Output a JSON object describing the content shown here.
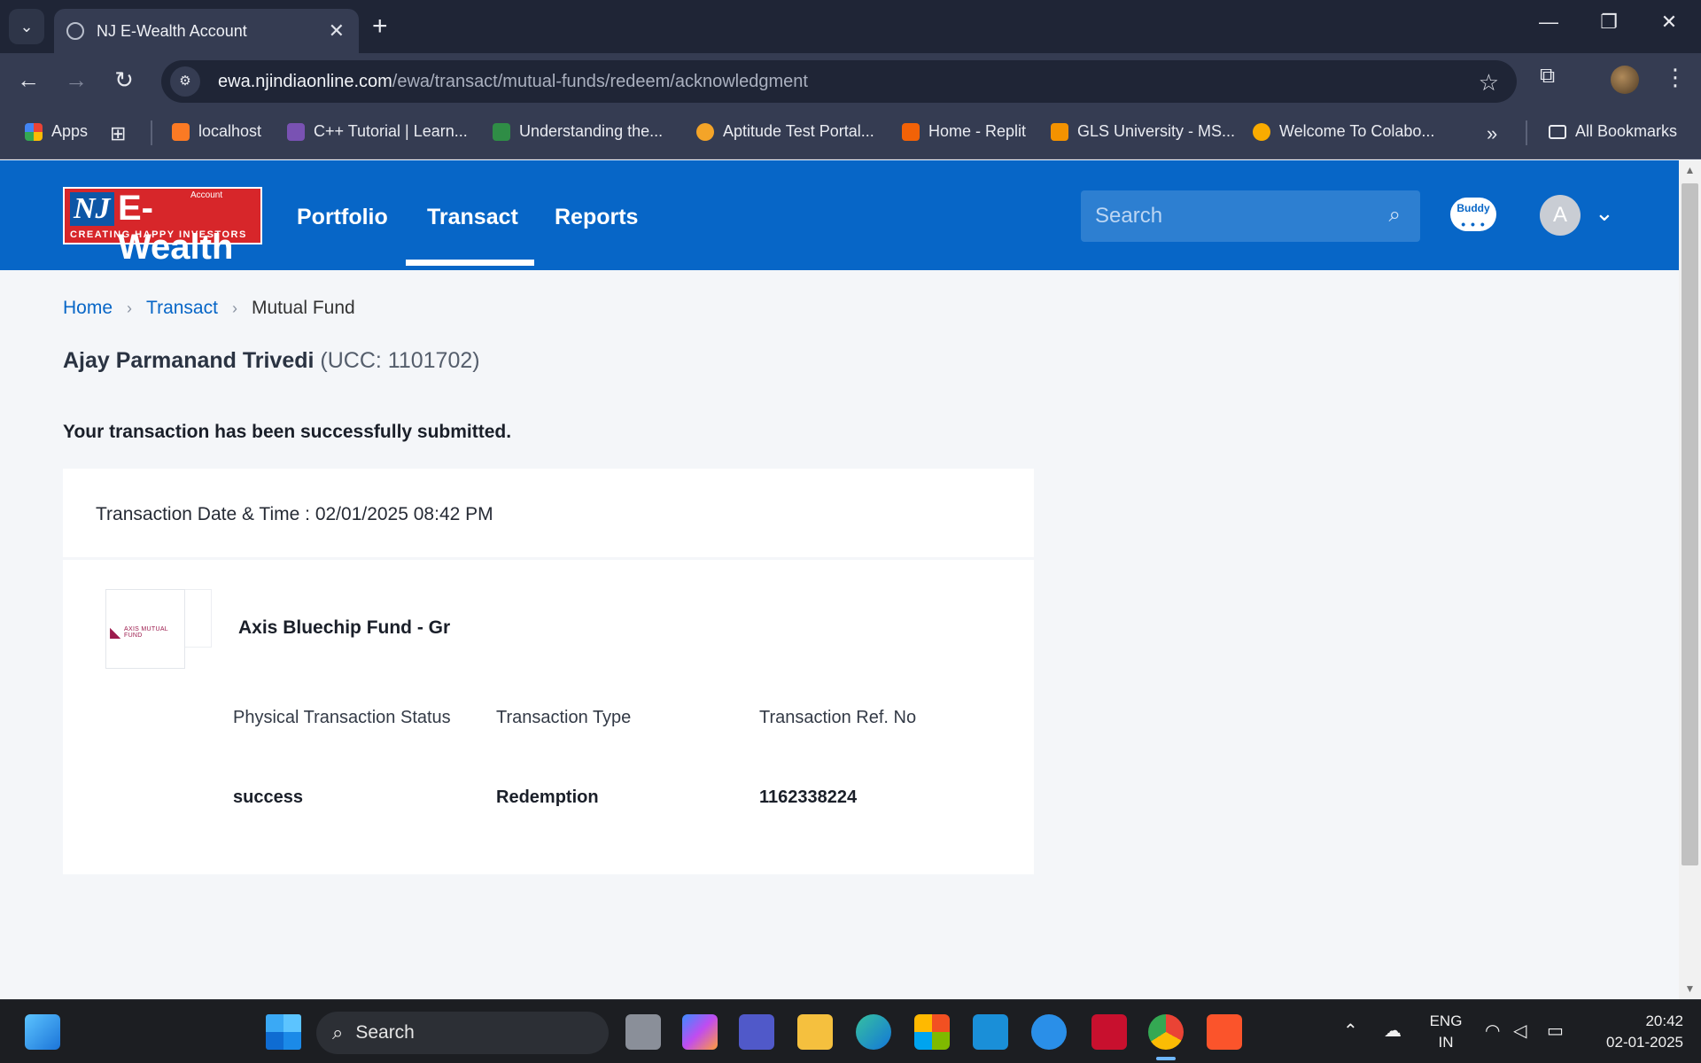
{
  "browser": {
    "tab_title": "NJ E-Wealth Account",
    "url_host": "ewa.njindiaonline.com",
    "url_path": "/ewa/transact/mutual-funds/redeem/acknowledgment",
    "bookmarks": [
      {
        "label": "Apps",
        "color": "#e8453c"
      },
      {
        "label": "localhost",
        "color": "#fb7a24"
      },
      {
        "label": "C++ Tutorial | Learn...",
        "color": "#7952b3"
      },
      {
        "label": "Understanding the...",
        "color": "#2f8d46"
      },
      {
        "label": "Aptitude Test Portal...",
        "color": "#f4a428"
      },
      {
        "label": "Home - Replit",
        "color": "#f26207"
      },
      {
        "label": "GLS University - MS...",
        "color": "#f39200"
      },
      {
        "label": "Welcome To Colabo...",
        "color": "#f9ab00"
      }
    ],
    "all_bookmarks_label": "All Bookmarks"
  },
  "site": {
    "logo": {
      "brand": "E-Wealth",
      "nj": "NJ",
      "account": "Account",
      "tagline": "CREATING HAPPY INVESTORS"
    },
    "menu": [
      "Portfolio",
      "Transact",
      "Reports"
    ],
    "active_menu": "Transact",
    "search_placeholder": "Search",
    "buddy_label": "Buddy",
    "avatar_initial": "A"
  },
  "breadcrumb": {
    "home": "Home",
    "transact": "Transact",
    "current": "Mutual Fund"
  },
  "client": {
    "name": "Ajay Parmanand Trivedi",
    "ucc": "(UCC: 1101702)"
  },
  "message": "Your transaction has been successfully submitted.",
  "transaction": {
    "date_time": "Transaction Date & Time : 02/01/2025 08:42 PM",
    "fund_logo_text": "AXIS MUTUAL FUND",
    "fund_name": "Axis Bluechip Fund - Gr",
    "labels": {
      "status": "Physical Transaction Status",
      "type": "Transaction Type",
      "ref": "Transaction Ref. No"
    },
    "values": {
      "status": "success",
      "type": "Redemption",
      "ref": "1162338224"
    }
  },
  "taskbar": {
    "search_label": "Search",
    "lang_top": "ENG",
    "lang_bottom": "IN",
    "time": "20:42",
    "date": "02-01-2025"
  }
}
